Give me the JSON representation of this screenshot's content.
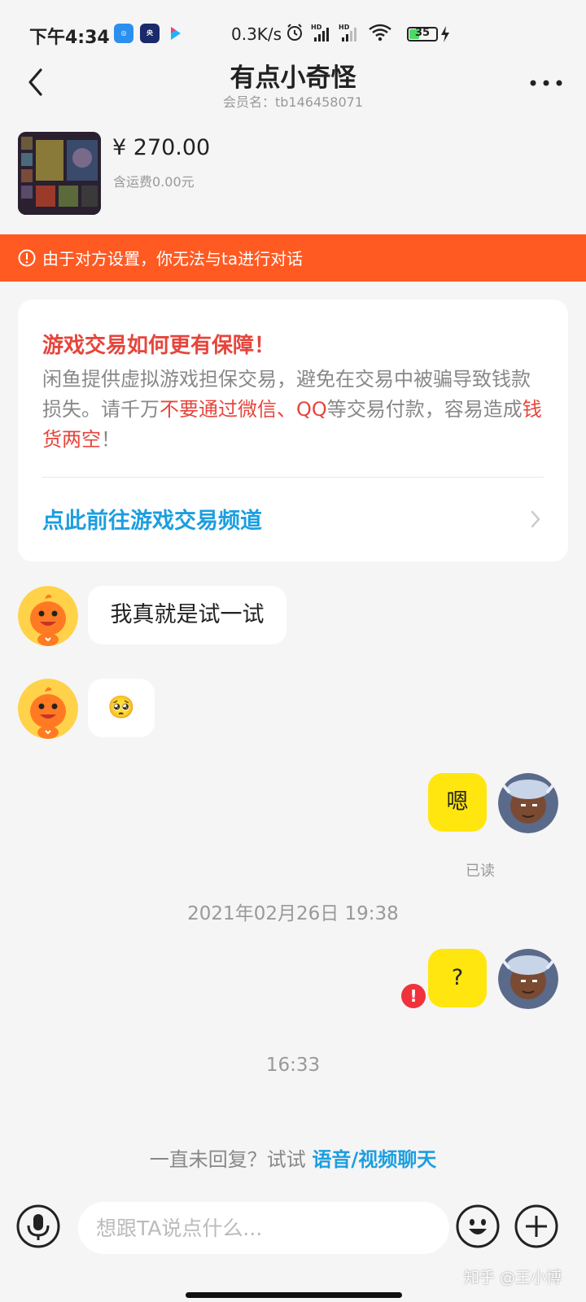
{
  "status_bar": {
    "time": "下午4:34",
    "app_icons": [
      "腾讯新闻",
      "央视新闻",
      "YOUKU"
    ],
    "net_speed": "0.3K/s",
    "battery": "35",
    "battery_level": 0.35
  },
  "header": {
    "title": "有点小奇怪",
    "subtitle": "会员名：tb146458071"
  },
  "product": {
    "price": "¥ 270.00",
    "shipping": "含运费0.00元"
  },
  "banner": {
    "text": "由于对方设置，你无法与ta进行对话"
  },
  "card": {
    "title": "游戏交易如何更有保障！",
    "body_1": "闲鱼提供虚拟游戏担保交易，避免在交易中被骗导致钱款损失。请千万",
    "body_red_1": "不要通过微信、QQ",
    "body_2": "等交易付款，容易造成",
    "body_red_2": "钱货两空",
    "body_3": "！",
    "link": "点此前往游戏交易频道"
  },
  "messages": [
    {
      "from": "other",
      "text": "我真就是试一试"
    },
    {
      "from": "other",
      "text": "🥺"
    },
    {
      "from": "me",
      "text": "嗯",
      "status": "已读"
    },
    {
      "from": "me",
      "text": "?",
      "status": "failed"
    }
  ],
  "time_separators": [
    "2021年02月26日 19:38",
    "16:33"
  ],
  "hint": {
    "prefix": "一直未回复？试试 ",
    "link": "语音/视频聊天"
  },
  "input": {
    "placeholder": "想跟TA说点什么..."
  },
  "watermark": "知乎 @王小博",
  "colors": {
    "accent_orange": "#ff5a22",
    "bubble_yellow": "#ffe60f",
    "link_blue": "#1c9ee0",
    "warning_red": "#e6453c"
  }
}
